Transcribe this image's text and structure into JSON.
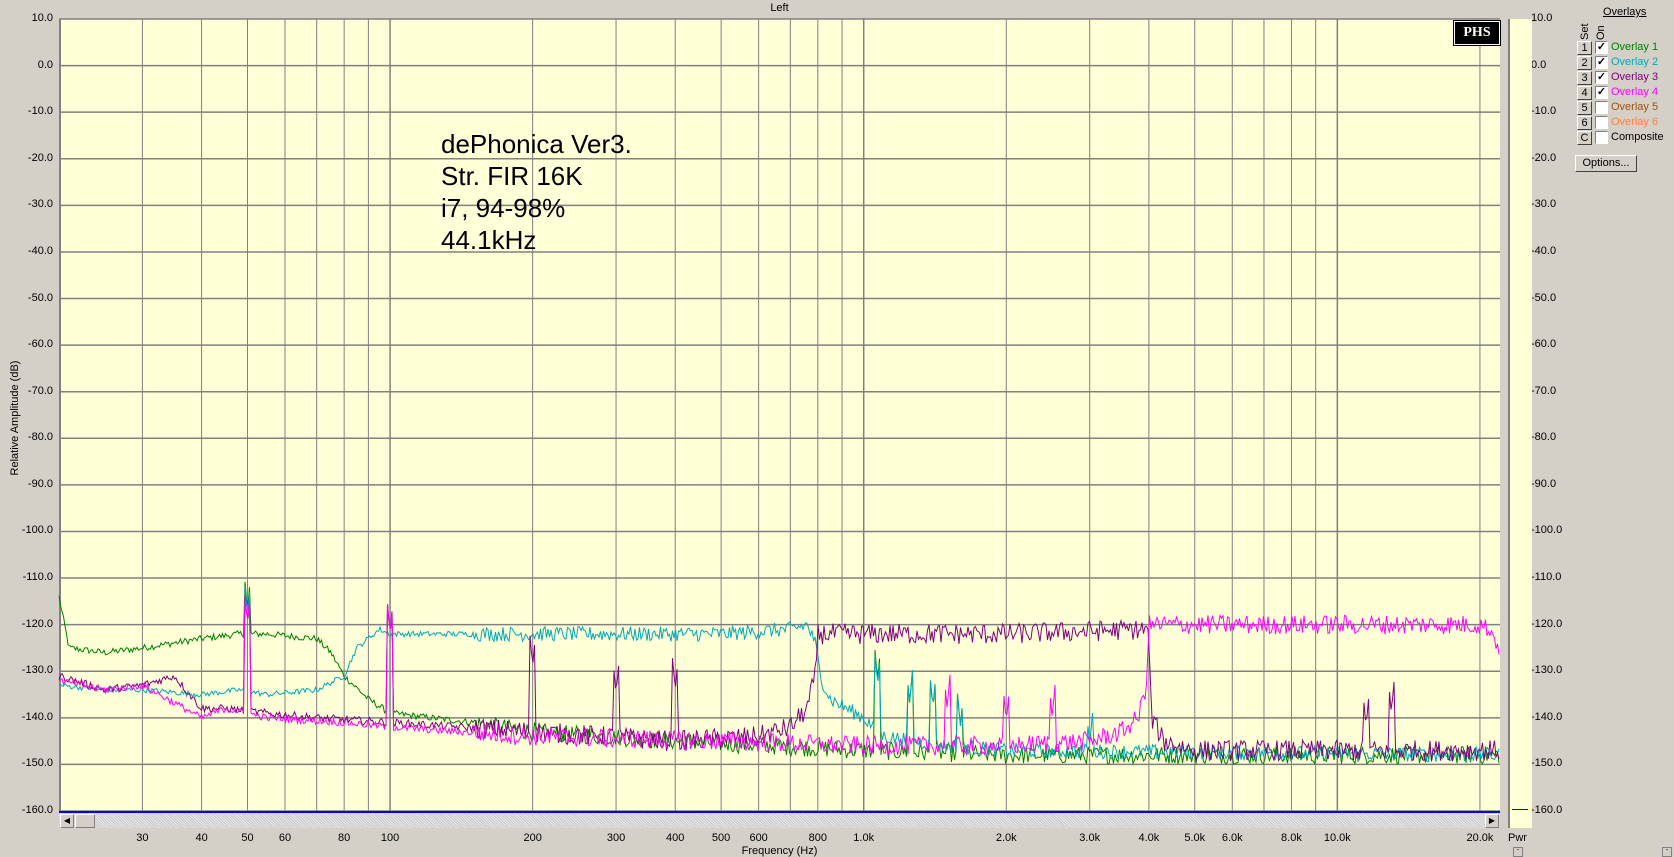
{
  "window": {
    "title": "Left",
    "logo": "PHS"
  },
  "annotation": [
    "dePhonica Ver3.",
    "Str. FIR 16K",
    "i7, 94-98%",
    "44.1kHz"
  ],
  "pwr_label": "Pwr",
  "overlays_panel": {
    "title": "Overlays",
    "set_header": "Set",
    "on_header": "On",
    "rows": [
      {
        "set": "1",
        "label": "Overlay 1",
        "checked": true,
        "color": "#008000"
      },
      {
        "set": "2",
        "label": "Overlay 2",
        "checked": true,
        "color": "#00a8b8"
      },
      {
        "set": "3",
        "label": "Overlay 3",
        "checked": true,
        "color": "#800080"
      },
      {
        "set": "4",
        "label": "Overlay 4",
        "checked": true,
        "color": "#ff00ff"
      },
      {
        "set": "5",
        "label": "Overlay 5",
        "checked": false,
        "color": "#a05010"
      },
      {
        "set": "6",
        "label": "Overlay 6",
        "checked": false,
        "color": "#ff8040"
      },
      {
        "set": "C",
        "label": "Composite",
        "checked": false,
        "color": "#000000"
      }
    ],
    "options_label": "Options..."
  },
  "chart_data": {
    "type": "line",
    "title": "Left",
    "xlabel": "Frequency (Hz)",
    "ylabel": "Relative Amplitude (dB)",
    "xscale": "log",
    "xlim": [
      20,
      22050
    ],
    "ylim": [
      -160,
      10
    ],
    "grid": true,
    "y_ticks": [
      "10.0",
      "0.0",
      "-10.0",
      "-20.0",
      "-30.0",
      "-40.0",
      "-50.0",
      "-60.0",
      "-70.0",
      "-80.0",
      "-90.0",
      "-100.0",
      "-110.0",
      "-120.0",
      "-130.0",
      "-140.0",
      "-150.0",
      "-160.0"
    ],
    "x_ticks": [
      {
        "v": 30,
        "label": "30"
      },
      {
        "v": 40,
        "label": "40"
      },
      {
        "v": 50,
        "label": "50"
      },
      {
        "v": 60,
        "label": "60"
      },
      {
        "v": 80,
        "label": "80"
      },
      {
        "v": 100,
        "label": "100"
      },
      {
        "v": 200,
        "label": "200"
      },
      {
        "v": 300,
        "label": "300"
      },
      {
        "v": 400,
        "label": "400"
      },
      {
        "v": 500,
        "label": "500"
      },
      {
        "v": 600,
        "label": "600"
      },
      {
        "v": 800,
        "label": "800"
      },
      {
        "v": 1000,
        "label": "1.0k"
      },
      {
        "v": 2000,
        "label": "2.0k"
      },
      {
        "v": 3000,
        "label": "3.0k"
      },
      {
        "v": 4000,
        "label": "4.0k"
      },
      {
        "v": 5000,
        "label": "5.0k"
      },
      {
        "v": 6000,
        "label": "6.0k"
      },
      {
        "v": 8000,
        "label": "8.0k"
      },
      {
        "v": 10000,
        "label": "10.0k"
      },
      {
        "v": 20000,
        "label": "20.0k"
      }
    ],
    "series": [
      {
        "name": "Overlay 1",
        "color": "#008000",
        "noise_db": 1.2,
        "points": [
          [
            20,
            -114
          ],
          [
            21,
            -125
          ],
          [
            25,
            -126
          ],
          [
            30,
            -125
          ],
          [
            40,
            -123
          ],
          [
            48,
            -122
          ],
          [
            55,
            -122
          ],
          [
            70,
            -123
          ],
          [
            75,
            -126
          ],
          [
            80,
            -131
          ],
          [
            90,
            -136
          ],
          [
            100,
            -139
          ],
          [
            150,
            -141
          ],
          [
            200,
            -143
          ],
          [
            400,
            -145
          ],
          [
            1000,
            -147
          ],
          [
            2000,
            -148
          ],
          [
            22000,
            -148
          ]
        ],
        "spikes": [
          [
            50,
            -117
          ],
          [
            100,
            -122
          ],
          [
            1070,
            -132
          ],
          [
            1250,
            -137
          ],
          [
            1400,
            -138
          ],
          [
            1600,
            -142
          ]
        ]
      },
      {
        "name": "Overlay 2",
        "color": "#00a8b8",
        "noise_db": 1.0,
        "points": [
          [
            20,
            -133
          ],
          [
            25,
            -134
          ],
          [
            30,
            -134
          ],
          [
            40,
            -135
          ],
          [
            48,
            -134
          ],
          [
            55,
            -135
          ],
          [
            70,
            -134
          ],
          [
            80,
            -131
          ],
          [
            85,
            -125
          ],
          [
            95,
            -121
          ],
          [
            100,
            -122
          ],
          [
            200,
            -122
          ],
          [
            500,
            -122
          ],
          [
            700,
            -121
          ],
          [
            760,
            -120
          ],
          [
            790,
            -124
          ],
          [
            810,
            -131
          ],
          [
            850,
            -136
          ],
          [
            1000,
            -140
          ],
          [
            1100,
            -144
          ],
          [
            1500,
            -146
          ],
          [
            2000,
            -147
          ],
          [
            22000,
            -148
          ]
        ],
        "spikes": [
          [
            50,
            -118
          ],
          [
            1070,
            -133
          ],
          [
            1250,
            -137
          ],
          [
            1400,
            -138
          ],
          [
            1600,
            -142
          ],
          [
            3000,
            -146
          ]
        ]
      },
      {
        "name": "Overlay 3",
        "color": "#800080",
        "noise_db": 1.4,
        "points": [
          [
            20,
            -131
          ],
          [
            25,
            -134
          ],
          [
            30,
            -133
          ],
          [
            35,
            -131
          ],
          [
            40,
            -138
          ],
          [
            45,
            -138
          ],
          [
            55,
            -139
          ],
          [
            70,
            -140
          ],
          [
            100,
            -141
          ],
          [
            200,
            -143
          ],
          [
            400,
            -145
          ],
          [
            600,
            -144
          ],
          [
            700,
            -142
          ],
          [
            760,
            -138
          ],
          [
            790,
            -131
          ],
          [
            800,
            -122
          ],
          [
            1000,
            -122
          ],
          [
            2000,
            -122
          ],
          [
            3900,
            -121
          ],
          [
            4000,
            -122
          ],
          [
            4050,
            -140
          ],
          [
            4300,
            -145
          ],
          [
            5000,
            -147
          ],
          [
            22000,
            -147
          ]
        ],
        "spikes": [
          [
            50,
            -120
          ],
          [
            100,
            -122
          ],
          [
            200,
            -129
          ],
          [
            300,
            -135
          ],
          [
            400,
            -134
          ],
          [
            11500,
            -142
          ],
          [
            13000,
            -139
          ]
        ]
      },
      {
        "name": "Overlay 4",
        "color": "#ff00ff",
        "noise_db": 1.3,
        "points": [
          [
            20,
            -132
          ],
          [
            25,
            -134
          ],
          [
            30,
            -133
          ],
          [
            40,
            -140
          ],
          [
            45,
            -138
          ],
          [
            55,
            -140
          ],
          [
            80,
            -141
          ],
          [
            100,
            -142
          ],
          [
            200,
            -144
          ],
          [
            500,
            -145
          ],
          [
            1000,
            -146
          ],
          [
            2000,
            -146
          ],
          [
            3000,
            -145
          ],
          [
            3500,
            -143
          ],
          [
            3800,
            -140
          ],
          [
            3950,
            -133
          ],
          [
            4000,
            -120
          ],
          [
            5000,
            -120
          ],
          [
            20000,
            -120
          ],
          [
            21000,
            -121
          ],
          [
            22000,
            -125
          ]
        ],
        "spikes": [
          [
            50,
            -120
          ],
          [
            100,
            -122
          ],
          [
            1500,
            -138
          ],
          [
            2000,
            -141
          ],
          [
            2500,
            -140
          ]
        ]
      }
    ]
  }
}
